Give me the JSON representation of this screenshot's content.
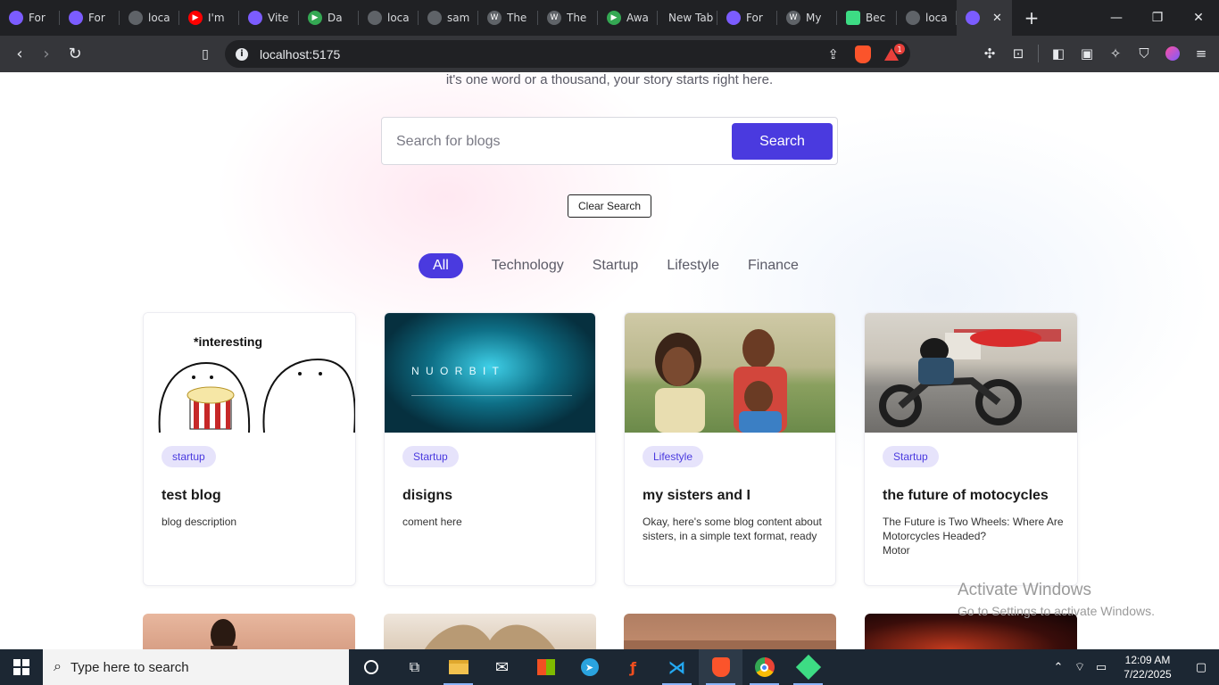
{
  "browser": {
    "tabs": [
      {
        "label": "For",
        "color": "#7b5cff"
      },
      {
        "label": "For",
        "color": "#7b5cff"
      },
      {
        "label": "loca",
        "color": "#9aa0a6"
      },
      {
        "label": "I'm",
        "color": "#ff0000"
      },
      {
        "label": "Vite",
        "color": "#7b5cff"
      },
      {
        "label": "Da",
        "color": "#34a853"
      },
      {
        "label": "loca",
        "color": "#9aa0a6"
      },
      {
        "label": "sam",
        "color": "#9aa0a6"
      },
      {
        "label": "The",
        "color": "#e8eaed"
      },
      {
        "label": "The",
        "color": "#e8eaed"
      },
      {
        "label": "Awa",
        "color": "#34a853"
      },
      {
        "label": "New Tab",
        "color": ""
      },
      {
        "label": "For",
        "color": "#7b5cff"
      },
      {
        "label": "My",
        "color": "#e8eaed"
      },
      {
        "label": "Bec",
        "color": "#3ddc84"
      },
      {
        "label": "loca",
        "color": "#9aa0a6"
      }
    ],
    "active_tab_close": "✕",
    "url": "localhost:5175",
    "notification_count": "1"
  },
  "page": {
    "tagline": "it's one word or a thousand, your story starts right here.",
    "search": {
      "placeholder": "Search for blogs",
      "button": "Search"
    },
    "clear_button": "Clear Search",
    "categories": [
      "All",
      "Technology",
      "Startup",
      "Lifestyle",
      "Finance"
    ],
    "accent_color": "#4a3adf",
    "cards": [
      {
        "tag": "startup",
        "title": "test blog",
        "desc": "blog description",
        "image_caption": "*interesting"
      },
      {
        "tag": "Startup",
        "title": "disigns",
        "desc": "coment here",
        "image_caption": "N U O R B I T"
      },
      {
        "tag": "Lifestyle",
        "title": "my sisters and I",
        "desc": "Okay, here's some blog content about sisters, in a simple text format, ready"
      },
      {
        "tag": "Startup",
        "title": "the future of motocycles",
        "desc": "The Future is Two Wheels: Where Are Motorcycles Headed?\nMotor"
      }
    ]
  },
  "watermark": {
    "line1": "Activate Windows",
    "line2": "Go to Settings to activate Windows."
  },
  "taskbar": {
    "search_placeholder": "Type here to search",
    "time": "12:09 AM",
    "date": "7/22/2025"
  }
}
